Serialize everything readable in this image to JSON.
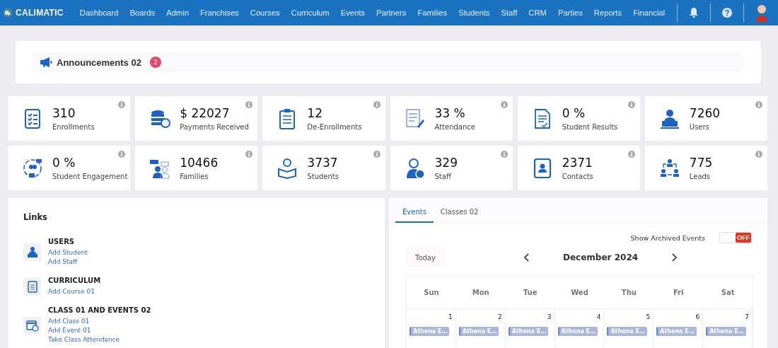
{
  "nav": {
    "logo": "CALIMATIC",
    "items": [
      "Dashboard",
      "Boards",
      "Admin",
      "Franchises",
      "Courses",
      "Curriculum",
      "Events",
      "Partners",
      "Families",
      "Students",
      "Staff",
      "CRM",
      "Parties",
      "Reports",
      "Financial"
    ]
  },
  "announcements": {
    "title": "Announcements 02",
    "count": "2"
  },
  "stats": [
    {
      "value": "310",
      "label": "Enrollments"
    },
    {
      "value": "$ 22027",
      "label": "Payments Received"
    },
    {
      "value": "12",
      "label": "De-Enrollments"
    },
    {
      "value": "33 %",
      "label": "Attendance"
    },
    {
      "value": "0 %",
      "label": "Student Results"
    },
    {
      "value": "7260",
      "label": "Users"
    },
    {
      "value": "0 %",
      "label": "Student Engagement"
    },
    {
      "value": "10466",
      "label": "Families"
    },
    {
      "value": "3737",
      "label": "Students"
    },
    {
      "value": "329",
      "label": "Staff"
    },
    {
      "value": "2371",
      "label": "Contacts"
    },
    {
      "value": "775",
      "label": "Leads"
    }
  ],
  "links": {
    "title": "Links",
    "groups": [
      {
        "heading": "USERS",
        "links": [
          "Add Student",
          "Add Staff"
        ]
      },
      {
        "heading": "CURRICULUM",
        "links": [
          "Add Course 01"
        ]
      },
      {
        "heading": "CLASS 01 AND EVENTS 02",
        "links": [
          "Add Class 01",
          "Add Event 01",
          "Take Class Attendance"
        ]
      }
    ]
  },
  "calendar": {
    "tabs": [
      {
        "label": "Events",
        "selected": true
      },
      {
        "label": "Classes 02",
        "selected": false
      }
    ],
    "archived": {
      "label": "Show Archived Events",
      "on": false,
      "state_text": "OFF"
    },
    "today": "Today",
    "month": "December 2024",
    "weekdays": [
      "Sun",
      "Mon",
      "Tue",
      "Wed",
      "Thu",
      "Fri",
      "Sat"
    ],
    "days": [
      {
        "date": "1",
        "events": [
          "Athena E…"
        ]
      },
      {
        "date": "2",
        "events": [
          "Athena E…"
        ]
      },
      {
        "date": "3",
        "events": [
          "Athena E…"
        ]
      },
      {
        "date": "4",
        "events": [
          "Athena E…"
        ]
      },
      {
        "date": "5",
        "events": [
          "Athena E…"
        ]
      },
      {
        "date": "6",
        "events": [
          "Athena E…"
        ]
      },
      {
        "date": "7",
        "events": [
          "Athena E…"
        ]
      }
    ]
  }
}
